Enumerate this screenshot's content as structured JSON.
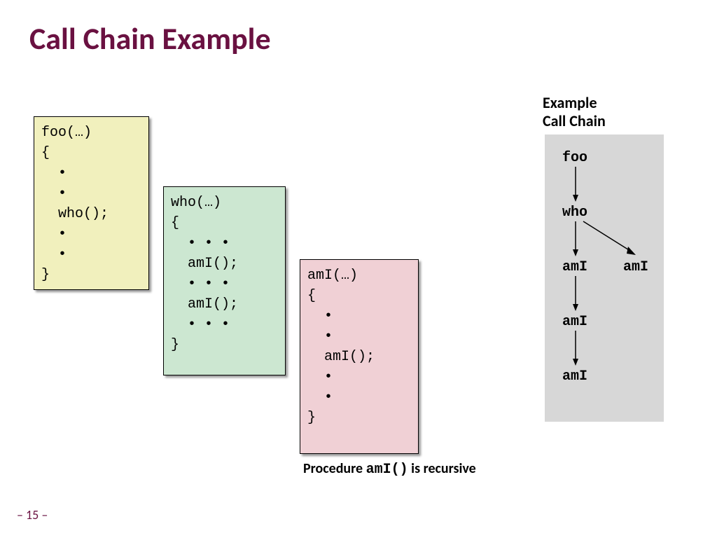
{
  "title": "Call Chain Example",
  "foo_code": "foo(…)\n{\n  •\n  •\n  who();\n  •\n  •\n}",
  "who_code": "who(…)\n{\n  • • •\n  amI();\n  • • •\n  amI();\n  • • •\n}",
  "amI_code": "amI(…)\n{\n  •\n  •\n  amI();\n  •\n  •\n}",
  "chain_label_l1": "Example",
  "chain_label_l2": "Call Chain",
  "chain": {
    "foo": "foo",
    "who": "who",
    "amI1": "amI",
    "amI_side": "amI",
    "amI2": "amI",
    "amI3": "amI"
  },
  "note_prefix": "Procedure ",
  "note_mono": "amI()",
  "note_suffix": " is recursive",
  "page_num": "– 15 –"
}
